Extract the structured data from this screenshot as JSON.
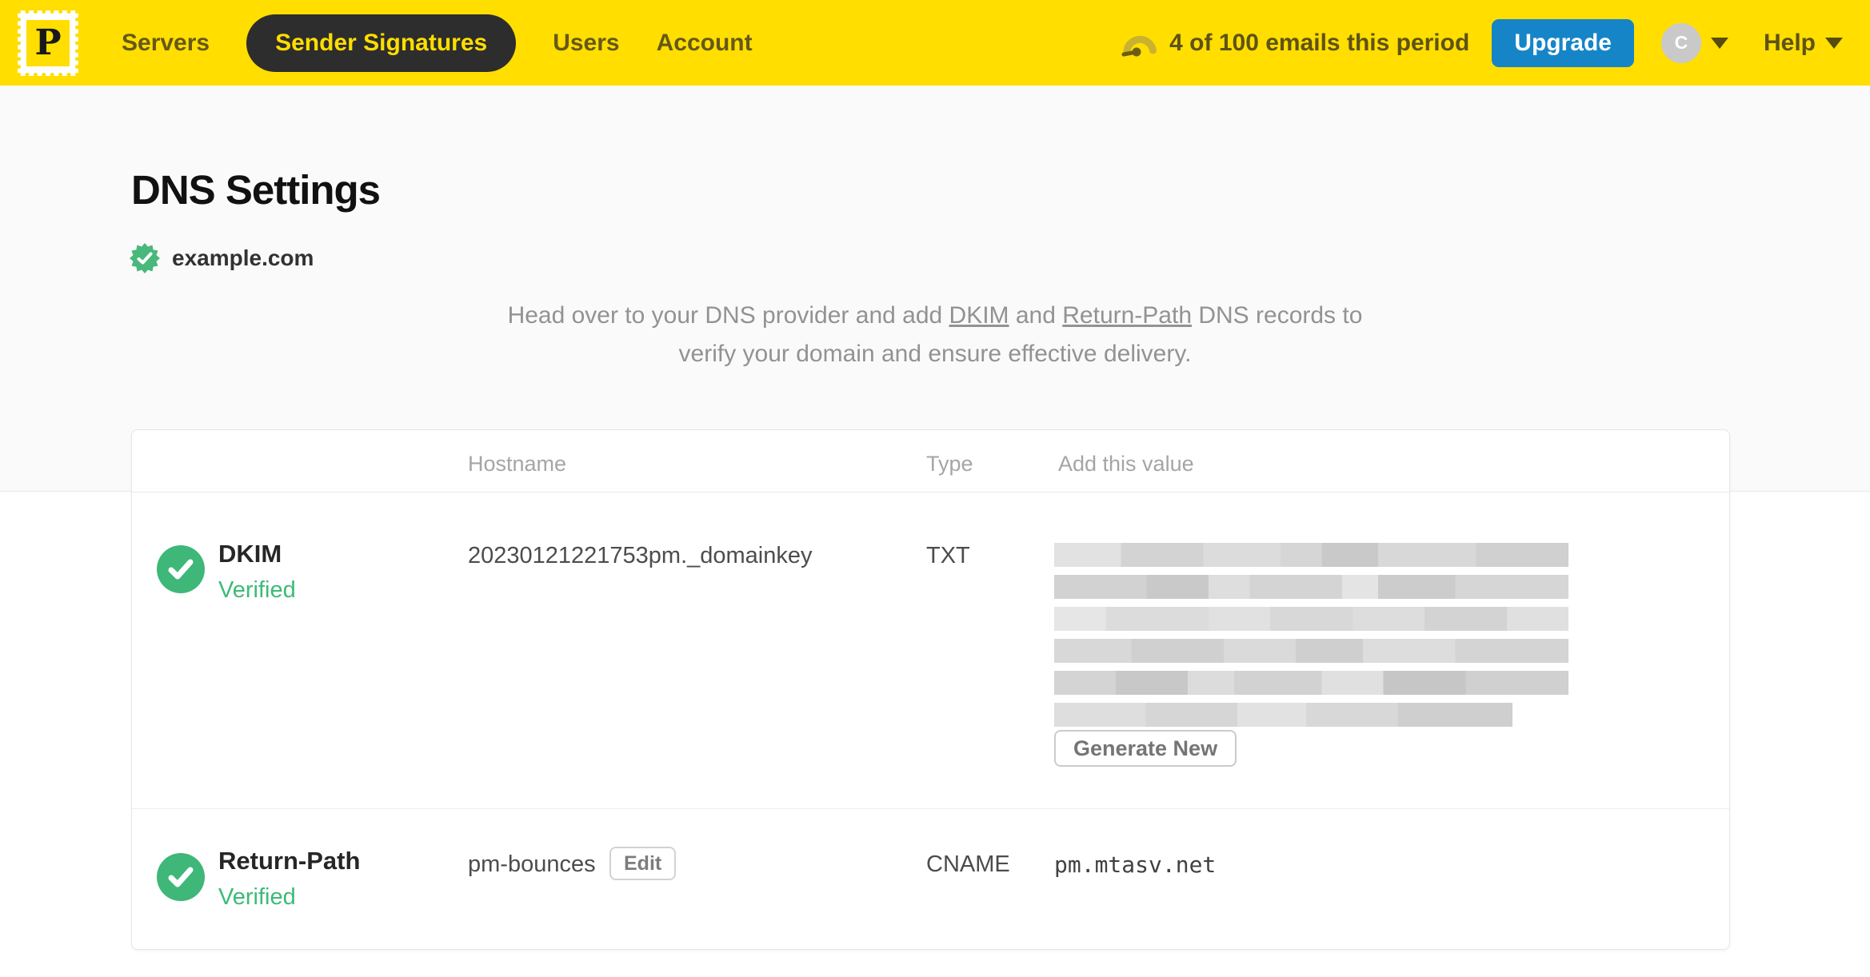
{
  "navbar": {
    "brand_letter": "P",
    "links": {
      "servers": "Servers",
      "sender_signatures": "Sender Signatures",
      "users": "Users",
      "account": "Account"
    },
    "usage_text": "4 of 100 emails this period",
    "upgrade_label": "Upgrade",
    "avatar_initial": "C",
    "help_label": "Help"
  },
  "page": {
    "title": "DNS Settings",
    "domain": "example.com",
    "description": {
      "line1_part1": "Head over to your DNS provider and add ",
      "dkim_link": "DKIM",
      "line1_part2": " and ",
      "return_path_link": "Return-Path",
      "line1_part3": " DNS records to",
      "line2": "verify your domain and ensure effective delivery."
    }
  },
  "table": {
    "headers": {
      "hostname": "Hostname",
      "type": "Type",
      "value": "Add this value"
    },
    "rows": [
      {
        "name": "DKIM",
        "status": "Verified",
        "hostname": "20230121221753pm._domainkey",
        "type": "TXT",
        "value_redacted": true,
        "action_label": "Generate New"
      },
      {
        "name": "Return-Path",
        "status": "Verified",
        "hostname": "pm-bounces",
        "edit_label": "Edit",
        "type": "CNAME",
        "value": "pm.mtasv.net"
      }
    ]
  },
  "colors": {
    "brand_yellow": "#FFDE00",
    "nav_pill_dark": "#2D2D2D",
    "upgrade_blue": "#1585C8",
    "success_green": "#3EB778",
    "muted_text": "#929292"
  }
}
